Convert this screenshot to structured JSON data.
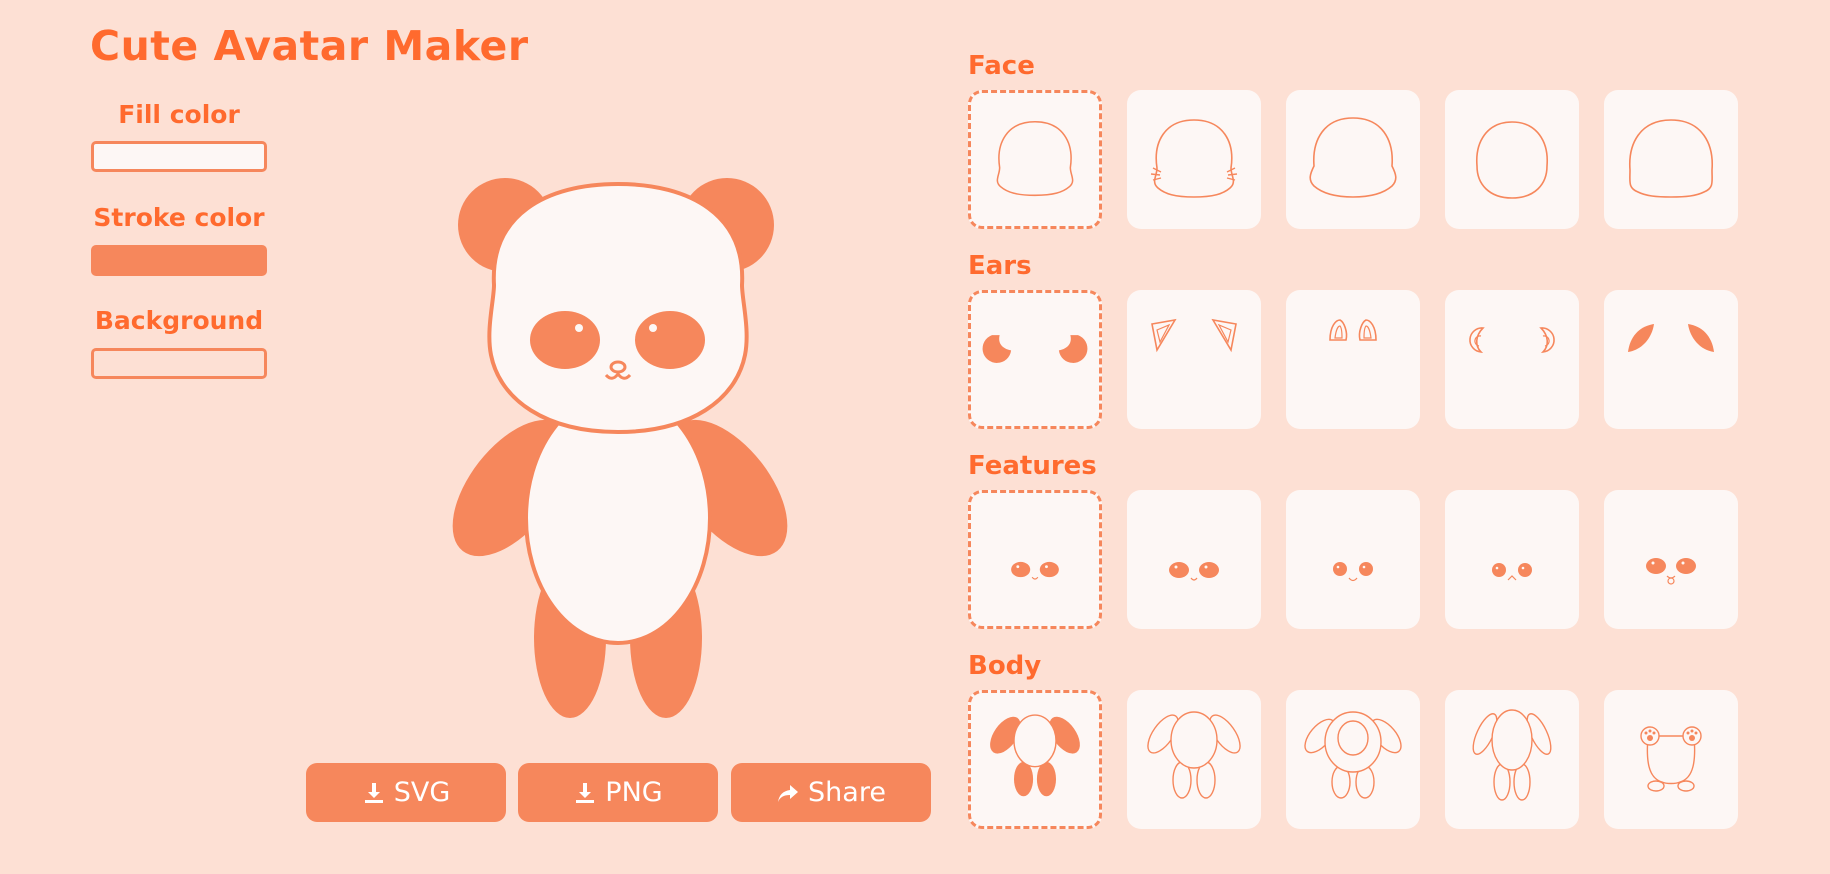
{
  "app": {
    "title": "Cute Avatar Maker"
  },
  "controls": {
    "fill": {
      "label": "Fill color",
      "value": "#fdf7f5"
    },
    "stroke": {
      "label": "Stroke color",
      "value": "#f6875c"
    },
    "background": {
      "label": "Background",
      "value": "#fde0d4"
    }
  },
  "actions": {
    "svg_label": "SVG",
    "png_label": "PNG",
    "share_label": "Share"
  },
  "sections": {
    "face": {
      "title": "Face",
      "selected_index": 0,
      "options": 5
    },
    "ears": {
      "title": "Ears",
      "selected_index": 0,
      "options": 5
    },
    "features": {
      "title": "Features",
      "selected_index": 0,
      "options": 5
    },
    "body": {
      "title": "Body",
      "selected_index": 0,
      "options": 5
    }
  },
  "colors": {
    "accent": "#ff6a2e",
    "stroke": "#f6875c",
    "tile": "#fdf7f5",
    "page": "#fde0d4"
  }
}
